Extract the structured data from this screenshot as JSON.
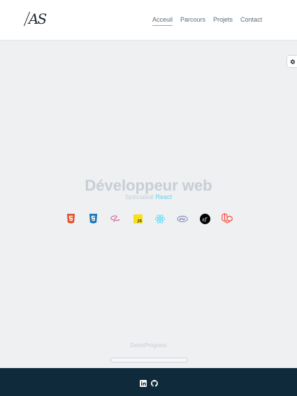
{
  "header": {
    "logo_text": "AS",
    "nav": [
      {
        "label": "Acceuil",
        "active": true
      },
      {
        "label": "Parcours",
        "active": false
      },
      {
        "label": "Projets",
        "active": false
      },
      {
        "label": "Contact",
        "active": false
      }
    ]
  },
  "settings": {
    "icon": "gear-icon"
  },
  "hero": {
    "title": "Développeur web",
    "subtitle_lead": "Spécialisé",
    "subtitle_accent": "React"
  },
  "skills": [
    {
      "icon": "html5-icon",
      "color": "#e44d26"
    },
    {
      "icon": "css3-icon",
      "color": "#1572b6"
    },
    {
      "icon": "sass-icon",
      "color": "#cd6799"
    },
    {
      "icon": "javascript-icon",
      "color": "#f7df1e"
    },
    {
      "icon": "react-icon",
      "color": "#61dafb"
    },
    {
      "icon": "php-icon",
      "color": "#777bb3"
    },
    {
      "icon": "symfony-icon",
      "color": "#000000"
    },
    {
      "icon": "laravel-icon",
      "color": "#ff2d20"
    }
  ],
  "progress": {
    "label_part1": "Devin",
    "label_part2": "Progress",
    "value": 0.0
  },
  "footer": {
    "icons": [
      "linkedin-icon",
      "github-icon"
    ],
    "background": "#0f2a3b"
  }
}
